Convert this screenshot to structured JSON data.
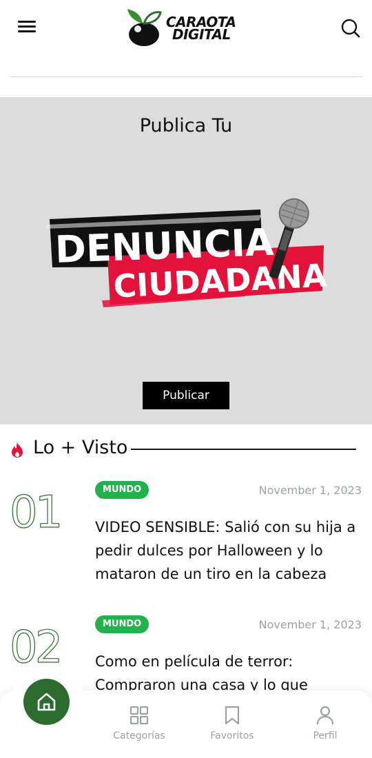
{
  "header": {
    "logo_line1": "CARAOTA",
    "logo_line2": "DIGITAL"
  },
  "banner": {
    "heading": "Publica Tu",
    "art_line1": "DENUNCIA",
    "art_line2": "CIUDADANA",
    "button_label": "Publicar"
  },
  "section": {
    "title": "Lo + Visto"
  },
  "articles": [
    {
      "rank": "01",
      "category": "MUNDO",
      "date": "November 1, 2023",
      "title": "VIDEO SENSIBLE: Salió con su hija a pedir dulces por Halloween y lo mataron de un tiro en la cabeza"
    },
    {
      "rank": "02",
      "category": "MUNDO",
      "date": "November 1, 2023",
      "title": "Como en película de terror: Compraron una casa y lo que"
    }
  ],
  "bottom_nav": {
    "items": [
      {
        "label": "Categorías",
        "icon": "grid-icon"
      },
      {
        "label": "Favoritos",
        "icon": "bookmark-icon"
      },
      {
        "label": "Perfil",
        "icon": "user-icon"
      }
    ]
  },
  "colors": {
    "brand_green": "#2e6b2e",
    "badge_green": "#22b24c",
    "banner_bg": "#dcdcdc",
    "accent_red": "#e3123a"
  }
}
